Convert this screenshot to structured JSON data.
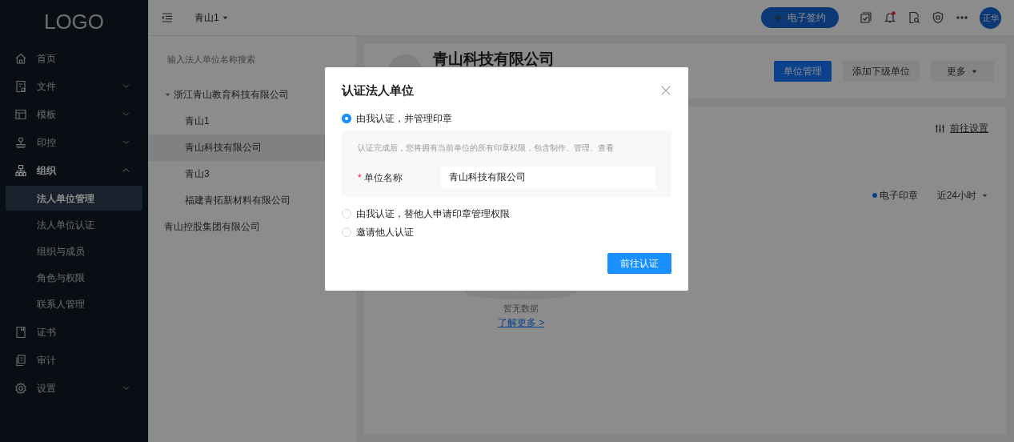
{
  "sidebar": {
    "logo": "LOGO",
    "items": [
      {
        "label": "首页",
        "selected": false
      },
      {
        "label": "文件",
        "selected": false,
        "expanded": false
      },
      {
        "label": "模板",
        "selected": false,
        "expanded": false
      },
      {
        "label": "印控",
        "selected": false,
        "expanded": false
      },
      {
        "label": "组织",
        "selected": true,
        "expanded": true,
        "children": [
          {
            "label": "法人单位管理",
            "selected": true
          },
          {
            "label": "法人单位认证",
            "selected": false
          },
          {
            "label": "组织与成员",
            "selected": false
          },
          {
            "label": "角色与权限",
            "selected": false
          },
          {
            "label": "联系人管理",
            "selected": false
          }
        ]
      },
      {
        "label": "证书",
        "selected": false
      },
      {
        "label": "审计",
        "selected": false
      },
      {
        "label": "设置",
        "selected": false,
        "expanded": false
      }
    ]
  },
  "topbar": {
    "project": "青山1",
    "sign_button": "电子签约",
    "notification": true,
    "avatar": "正华"
  },
  "tree": {
    "search": {
      "placeholder": "输入法人单位名称搜索"
    },
    "nodes": [
      {
        "label": "浙江青山教育科技有限公司",
        "selected": false,
        "expanded": true,
        "children": [
          {
            "label": "青山1",
            "selected": false
          },
          {
            "label": "青山科技有限公司",
            "selected": true
          },
          {
            "label": "青山3",
            "selected": false
          },
          {
            "label": "福建青拓新材料有限公司",
            "selected": false
          }
        ]
      },
      {
        "label": "青山控股集团有限公司",
        "selected": false
      }
    ]
  },
  "unit": {
    "title": "青山科技有限公司",
    "buttons": [
      {
        "label": "单位管理",
        "kind": "primary"
      },
      {
        "label": "添加下级单位",
        "kind": "default"
      },
      {
        "label": "更多",
        "kind": "dropdown"
      }
    ],
    "settings_link": "前往设置",
    "legend": {
      "label": "电子印章"
    },
    "period": "近24小时",
    "empty_text": "暂无数据",
    "learn_more": "了解更多 >"
  },
  "dialog": {
    "title": "认证法人单位",
    "options": [
      {
        "label": "由我认证，并管理印章",
        "selected": true,
        "note": "认证完成后，您将拥有当前单位的所有印章权限，包含制作、管理、查看",
        "field": {
          "required_mark": "*",
          "label": "单位名称",
          "value": "青山科技有限公司"
        }
      },
      {
        "label": "由我认证，替他人申请印章管理权限",
        "selected": false
      },
      {
        "label": "邀请他人认证",
        "selected": false
      }
    ],
    "submit": "前往认证"
  }
}
